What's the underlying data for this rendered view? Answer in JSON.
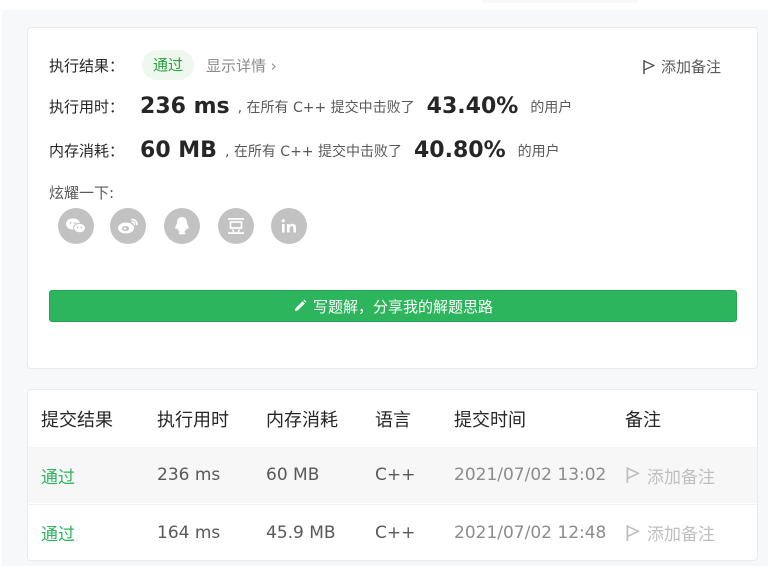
{
  "result": {
    "label": "执行结果：",
    "status_badge": "通过",
    "detail_link": "显示详情 ›",
    "add_note": "添加备注",
    "runtime": {
      "label": "执行用时：",
      "value": "236 ms",
      "text": ", 在所有 C++ 提交中击败了",
      "percent": "43.40%",
      "suffix": "的用户"
    },
    "memory": {
      "label": "内存消耗：",
      "value": "60 MB",
      "text": ", 在所有 C++ 提交中击败了",
      "percent": "40.80%",
      "suffix": "的用户"
    },
    "share_label": "炫耀一下:",
    "social_icons": [
      "wechat-icon",
      "weibo-icon",
      "qq-icon",
      "douban-icon",
      "linkedin-icon"
    ],
    "write_solution": "写题解，分享我的解题思路"
  },
  "submissions": {
    "headers": [
      "提交结果",
      "执行用时",
      "内存消耗",
      "语言",
      "提交时间",
      "备注"
    ],
    "rows": [
      {
        "status": "通过",
        "runtime": "236 ms",
        "memory": "60 MB",
        "language": "C++",
        "time": "2021/07/02 13:02",
        "note": "添加备注"
      },
      {
        "status": "通过",
        "runtime": "164 ms",
        "memory": "45.9 MB",
        "language": "C++",
        "time": "2021/07/02 12:48",
        "note": "添加备注"
      }
    ]
  },
  "colors": {
    "accent_green": "#2db55d",
    "badge_bg": "#eef8ef",
    "icon_gray": "#c2c2c2"
  }
}
